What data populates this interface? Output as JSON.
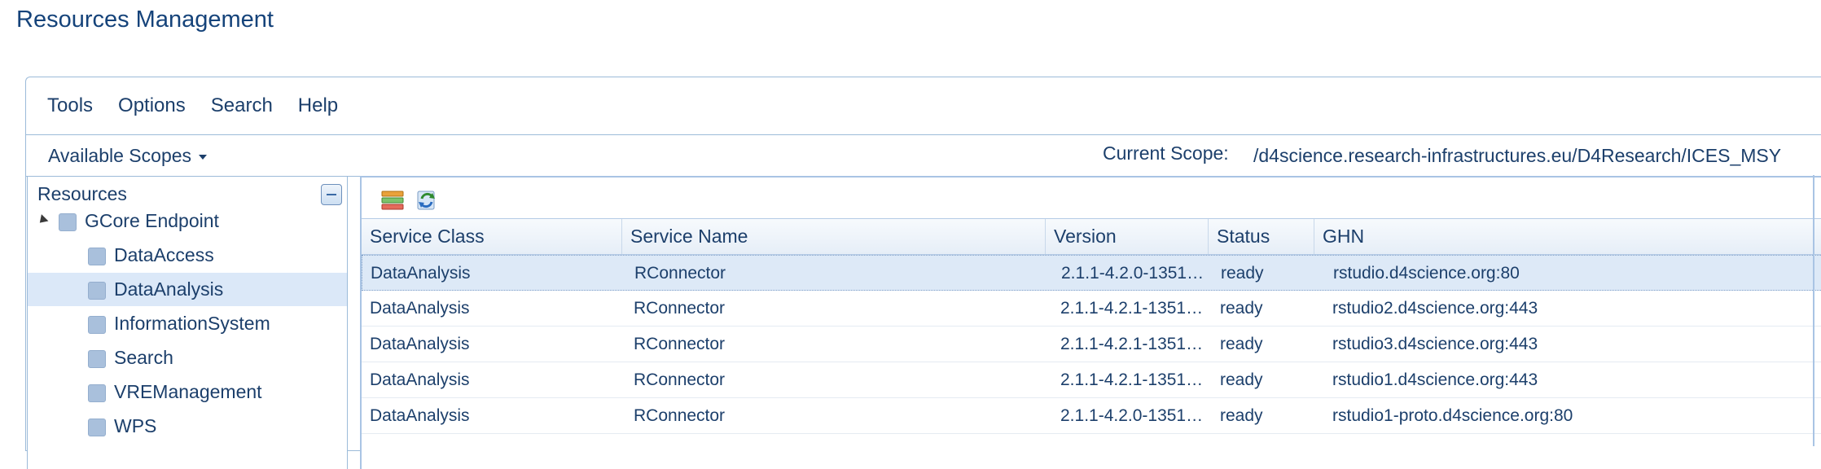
{
  "page": {
    "title": "Resources Management"
  },
  "menu": {
    "items": [
      "Tools",
      "Options",
      "Search",
      "Help"
    ]
  },
  "scope": {
    "dropdown_label": "Available Scopes",
    "current_label": "Current Scope:",
    "current_value": "/d4science.research-infrastructures.eu/D4Research/ICES_MSY"
  },
  "resources": {
    "title": "Resources",
    "tree": [
      {
        "label": "GCore Endpoint",
        "level": 0,
        "expanded": true,
        "selected": false
      },
      {
        "label": "DataAccess",
        "level": 1,
        "selected": false
      },
      {
        "label": "DataAnalysis",
        "level": 1,
        "selected": true
      },
      {
        "label": "InformationSystem",
        "level": 1,
        "selected": false
      },
      {
        "label": "Search",
        "level": 1,
        "selected": false
      },
      {
        "label": "VREManagement",
        "level": 1,
        "selected": false
      },
      {
        "label": "WPS",
        "level": 1,
        "selected": false
      }
    ]
  },
  "toolbar": {
    "icons": [
      "grid-view-icon",
      "refresh-icon"
    ]
  },
  "grid": {
    "columns": [
      "Service Class",
      "Service Name",
      "Version",
      "Status",
      "GHN"
    ],
    "rows": [
      [
        "DataAnalysis",
        "RConnector",
        "2.1.1-4.2.0-1351…",
        "ready",
        "rstudio.d4science.org:80"
      ],
      [
        "DataAnalysis",
        "RConnector",
        "2.1.1-4.2.1-1351…",
        "ready",
        "rstudio2.d4science.org:443"
      ],
      [
        "DataAnalysis",
        "RConnector",
        "2.1.1-4.2.1-1351…",
        "ready",
        "rstudio3.d4science.org:443"
      ],
      [
        "DataAnalysis",
        "RConnector",
        "2.1.1-4.2.1-1351…",
        "ready",
        "rstudio1.d4science.org:443"
      ],
      [
        "DataAnalysis",
        "RConnector",
        "2.1.1-4.2.0-1351…",
        "ready",
        "rstudio1-proto.d4science.org:80"
      ]
    ],
    "selected_row": 0
  },
  "colors": {
    "title": "#15437a",
    "text": "#1c3f6b",
    "border": "#9cbbd9",
    "selection": "#dbe8f8"
  }
}
